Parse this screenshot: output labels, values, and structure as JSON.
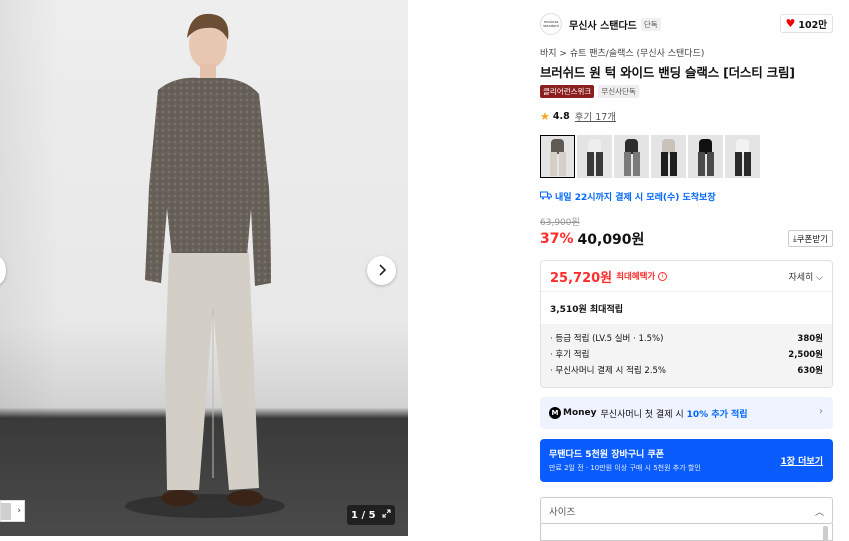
{
  "gallery": {
    "counter": "1 / 5",
    "next_icon": "chevron-right-icon",
    "expand_icon": "expand-icon"
  },
  "brand": {
    "logo_text": "musinsa standard",
    "name": "무신사 스탠다드",
    "tag": "단독",
    "likes": "102만"
  },
  "product": {
    "breadcrumb": "바지 > 슈트 팬츠/슬랙스 (무신사 스탠다드)",
    "title": "브러쉬드 원 턱 와이드 밴딩 슬랙스 [더스티 크림]",
    "badge_clearance": "클리어런스위크",
    "badge_exclusive": "무신사단독",
    "rating": "4.8",
    "reviews": "후기 17개",
    "delivery": "내일 22시까지 결제 시 모레(수) 도착보장",
    "original_price": "63,900원",
    "discount": "37%",
    "price": "40,090원",
    "coupon_button": "쿠폰받기"
  },
  "benefits": {
    "max_price": "25,720원",
    "max_label": "최대혜택가",
    "detail": "자세히",
    "points_total": "3,510원 최대적립",
    "rows": [
      {
        "label": "· 등급 적립 (LV.5 실버 · 1.5%)",
        "value": "380원"
      },
      {
        "label": "· 후기 적립",
        "value": "2,500원"
      },
      {
        "label": "· 무신사머니 결제 시 적립 2.5%",
        "value": "630원"
      }
    ]
  },
  "money": {
    "logo": "M",
    "word": "Money",
    "text": "무신사머니 첫 결제 시",
    "accent": "10% 추가 적립"
  },
  "coupon_banner": {
    "title": "무탠다드 5천원 장바구니 쿠폰",
    "subtitle": "만료 2일 전 · 10만원 이상 구매 시 5천원 추가 할인",
    "more": "1장 더보기"
  },
  "size": {
    "placeholder": "사이즈"
  },
  "colors": {
    "accent_blue": "#0066ff",
    "sale_red": "#ff2d2d",
    "banner_blue": "#0a5cff"
  }
}
